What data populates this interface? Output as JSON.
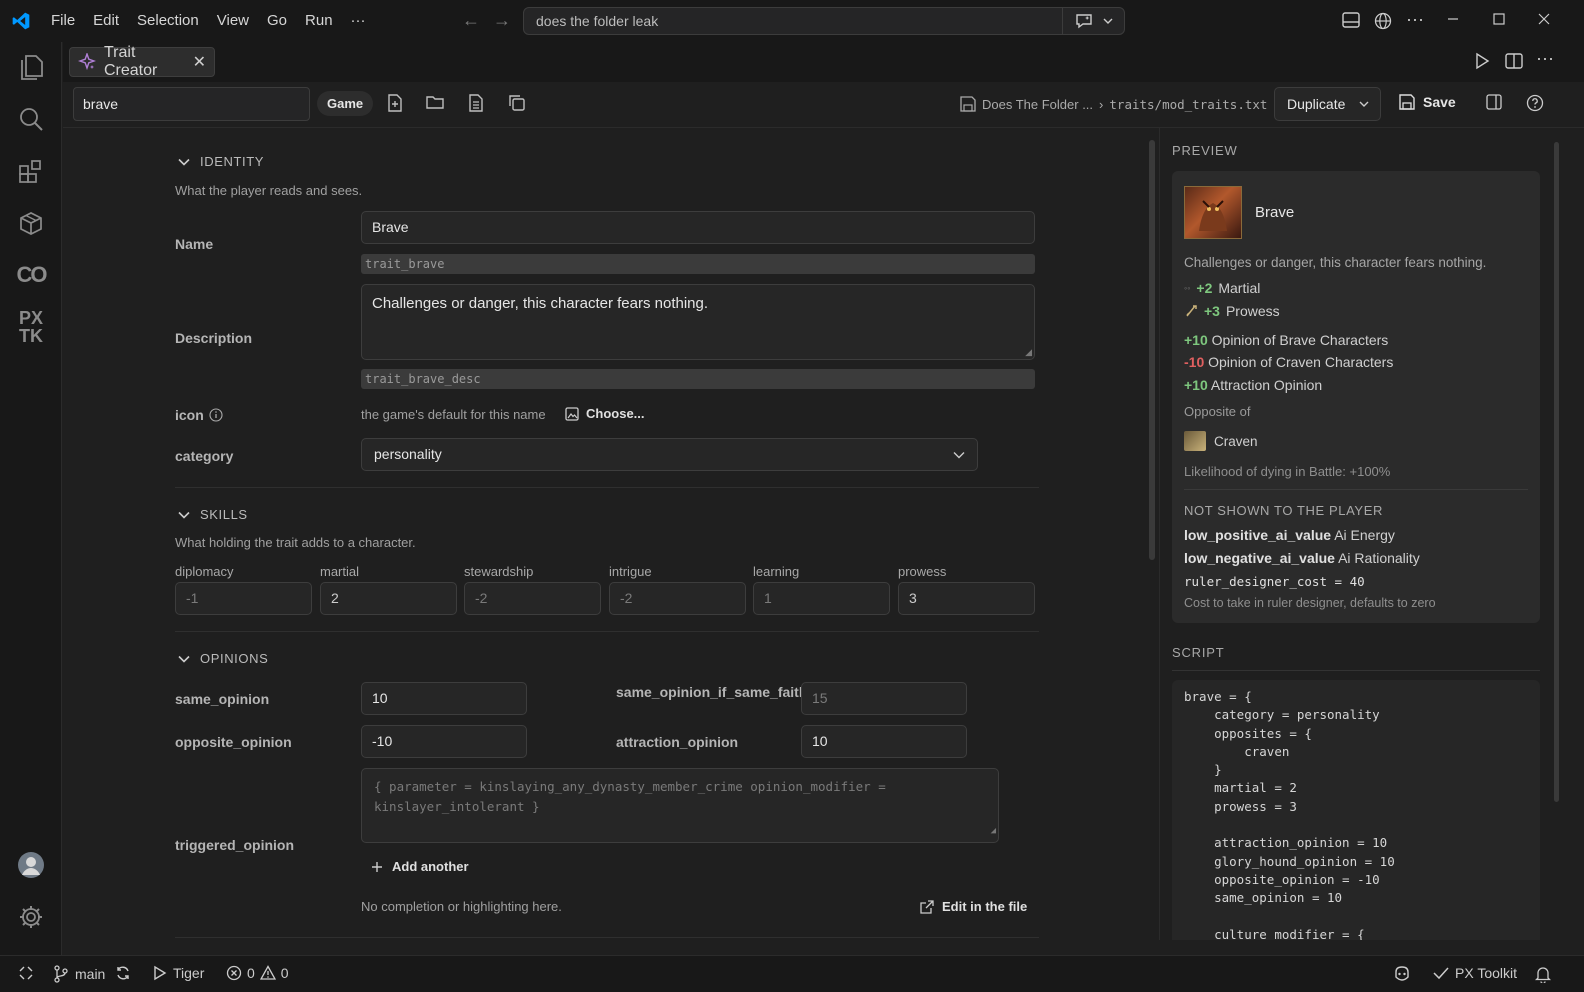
{
  "menu": [
    "File",
    "Edit",
    "Selection",
    "View",
    "Go",
    "Run",
    "···"
  ],
  "command_center": {
    "text": "does the folder leak"
  },
  "tab": {
    "label": "Trait Creator"
  },
  "toolbar": {
    "search_value": "brave",
    "game_label": "Game",
    "crumb_project": "Does The Folder ...",
    "crumb_sep": "›",
    "crumb_file": "traits/mod_traits.txt",
    "duplicate_label": "Duplicate",
    "save_label": "Save"
  },
  "identity": {
    "header": "IDENTITY",
    "subtitle": "What the player reads and sees.",
    "name_label": "Name",
    "name_value": "Brave",
    "name_key": "trait_brave",
    "desc_label": "Description",
    "desc_value": "Challenges or danger, this character fears nothing.",
    "desc_key": "trait_brave_desc",
    "icon_label": "icon",
    "icon_hint": "the game's default for this name",
    "choose_label": "Choose...",
    "category_label": "category",
    "category_value": "personality"
  },
  "skills": {
    "header": "SKILLS",
    "subtitle": "What holding the trait adds to a character.",
    "items": [
      {
        "label": "diplomacy",
        "value": "-1",
        "placeholder": true
      },
      {
        "label": "martial",
        "value": "2",
        "placeholder": false
      },
      {
        "label": "stewardship",
        "value": "-2",
        "placeholder": true
      },
      {
        "label": "intrigue",
        "value": "-2",
        "placeholder": true
      },
      {
        "label": "learning",
        "value": "1",
        "placeholder": true
      },
      {
        "label": "prowess",
        "value": "3",
        "placeholder": false
      }
    ]
  },
  "opinions": {
    "header": "OPINIONS",
    "same_opinion_label": "same_opinion",
    "same_opinion_value": "10",
    "same_faith_label": "same_opinion_if_same_faith",
    "same_faith_placeholder": "15",
    "opposite_label": "opposite_opinion",
    "opposite_value": "-10",
    "attraction_label": "attraction_opinion",
    "attraction_value": "10",
    "triggered_label": "triggered_opinion",
    "triggered_placeholder": "{ parameter = kinslaying_any_dynasty_member_crime opinion_modifier = kinslayer_intolerant }",
    "add_another": "Add another",
    "no_completion": "No completion or highlighting here.",
    "edit_in_file": "Edit in the file"
  },
  "preview": {
    "header": "PREVIEW",
    "trait_name": "Brave",
    "description": "Challenges or danger, this character fears nothing.",
    "skill_lines": [
      {
        "amount": "+2",
        "name": "Martial"
      },
      {
        "amount": "+3",
        "name": "Prowess"
      }
    ],
    "modifier_lines": [
      {
        "amount": "+10",
        "text": "Opinion of Brave Characters",
        "sign": "pos"
      },
      {
        "amount": "-10",
        "text": "Opinion of Craven Characters",
        "sign": "neg"
      },
      {
        "amount": "+10",
        "text": "Attraction Opinion",
        "sign": "pos"
      }
    ],
    "opposite_label": "Opposite of",
    "opposite_trait": "Craven",
    "death_line": "Likelihood of dying in Battle: +100%",
    "hidden_header": "NOT SHOWN TO THE PLAYER",
    "hidden_lines": [
      {
        "key": "low_positive_ai_value",
        "value": "Ai Energy"
      },
      {
        "key": "low_negative_ai_value",
        "value": "Ai Rationality"
      }
    ],
    "ruler_cost": "ruler_designer_cost = 40",
    "ruler_note": "Cost to take in ruler designer, defaults to zero"
  },
  "script": {
    "header": "SCRIPT",
    "code": "brave = {\n\tcategory = personality\n\topposites = {\n\t\tcraven\n\t}\n\tmartial = 2\n\tprowess = 3\n\n\tattraction_opinion = 10\n\tglory_hound_opinion = 10\n\topposite_opinion = -10\n\tsame_opinion = 10\n\n\tculture_modifier = {"
  },
  "statusbar": {
    "branch": "main",
    "run_target": "Tiger",
    "errors": "0",
    "warnings": "0",
    "extension": "PX Toolkit"
  },
  "activity": {
    "px_label": "PX\nTK"
  },
  "colors": {
    "accent": "#0098ff",
    "positive": "#7ec77e",
    "negative": "#e06060"
  }
}
